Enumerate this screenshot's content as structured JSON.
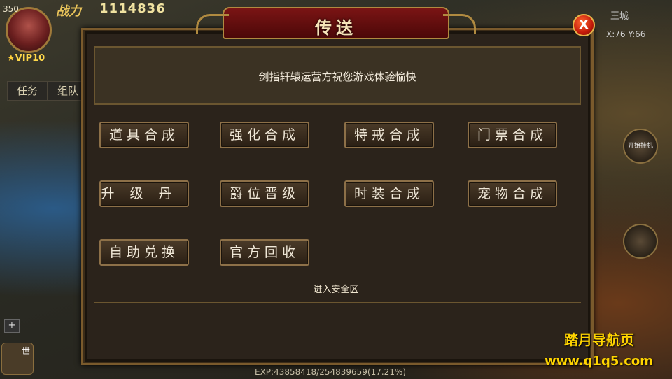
{
  "hud": {
    "level": "350",
    "combat_label": "战力",
    "combat_value": "1114836",
    "vip": "VIP10",
    "tabs": [
      "任务",
      "组队"
    ],
    "location": "王城",
    "coords": "X:76 Y:66",
    "auto_battle_label": "开始挂机",
    "exp": "EXP:43858418/254839659(17.21%)",
    "chat_world_label": "世"
  },
  "dialog": {
    "title": "传送",
    "close_label": "X",
    "message": "剑指轩辕运营方祝您游戏体验愉快",
    "options": [
      "道具合成",
      "强化合成",
      "特戒合成",
      "门票合成",
      "升级丹",
      "爵位晋级",
      "时装合成",
      "宠物合成",
      "自助兑换",
      "官方回收"
    ],
    "safe_zone_label": "进入安全区"
  },
  "watermark": {
    "title": "踏月导航页",
    "url": "www.q1q5.com"
  }
}
